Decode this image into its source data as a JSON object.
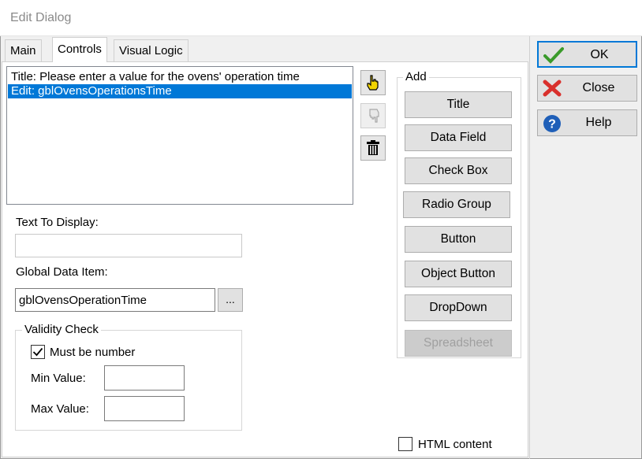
{
  "window": {
    "title": "Edit Dialog"
  },
  "tabs": [
    {
      "label": "Main"
    },
    {
      "label": "Controls"
    },
    {
      "label": "Visual Logic"
    }
  ],
  "controls_list": {
    "items": [
      {
        "text": "Title: Please enter a value for the ovens' operation time",
        "selected": false
      },
      {
        "text": "Edit:  gblOvensOperationsTime",
        "selected": true
      }
    ]
  },
  "list_tools": {
    "move_up_icon": "hand-pointer-icon",
    "move_down_icon": "hand-pointer-disabled-icon",
    "delete_icon": "trash-icon"
  },
  "add_group": {
    "label": "Add",
    "buttons": [
      {
        "label": "Title",
        "enabled": true
      },
      {
        "label": "Data Field",
        "enabled": true
      },
      {
        "label": "Check Box",
        "enabled": true
      },
      {
        "label": "Radio Group",
        "enabled": true
      },
      {
        "label": "Button",
        "enabled": true
      },
      {
        "label": "Object Button",
        "enabled": true
      },
      {
        "label": "DropDown",
        "enabled": true
      },
      {
        "label": "Spreadsheet",
        "enabled": false
      }
    ]
  },
  "fields": {
    "text_to_display": {
      "label": "Text To Display:",
      "value": ""
    },
    "global_data_item": {
      "label": "Global Data Item:",
      "value": "gblOvensOperationTime",
      "browse_label": "..."
    }
  },
  "validity": {
    "label": "Validity Check",
    "must_be_number": {
      "label": "Must be number",
      "checked": true
    },
    "min": {
      "label": "Min Value:",
      "value": ""
    },
    "max": {
      "label": "Max Value:",
      "value": ""
    }
  },
  "html_content": {
    "label": "HTML content",
    "checked": false
  },
  "side_buttons": {
    "ok": "OK",
    "close": "Close",
    "help": "Help"
  },
  "colors": {
    "accent": "#0078d7",
    "ok_green": "#3a9a2a",
    "close_red": "#d9302c",
    "help_blue": "#1f5fb8"
  }
}
